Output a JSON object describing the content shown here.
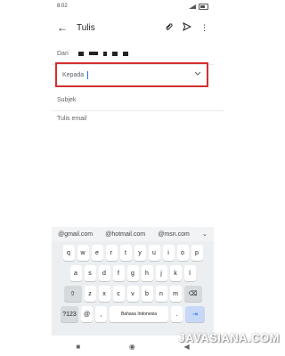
{
  "status": {
    "time": "8:02"
  },
  "app_bar": {
    "back_icon": "arrow-left-icon",
    "title": "Tulis",
    "icons": [
      "paperclip-icon",
      "send-icon",
      "more-vertical-icon"
    ]
  },
  "compose": {
    "from_label": "Dari",
    "to_label": "Kepada",
    "subject_placeholder": "Subjek",
    "body_placeholder": "Tulis email",
    "expand_icon": "chevron-down-icon"
  },
  "suggestions": [
    "@gmail.com",
    "@hotmail.com",
    "@msn.com"
  ],
  "keyboard": {
    "row1": [
      "q",
      "w",
      "e",
      "r",
      "t",
      "y",
      "u",
      "i",
      "o",
      "p"
    ],
    "row2": [
      "a",
      "s",
      "d",
      "f",
      "g",
      "h",
      "j",
      "k",
      "l"
    ],
    "row3": [
      "z",
      "x",
      "c",
      "v",
      "b",
      "n",
      "m"
    ],
    "symbols": "?123",
    "at": "@",
    "comma": ",",
    "space": "Bahasa Indonesia",
    "period": "."
  },
  "watermark": "JAVASIANA.COM",
  "accent": "#1a73e8",
  "highlight_color": "#d32f2f"
}
